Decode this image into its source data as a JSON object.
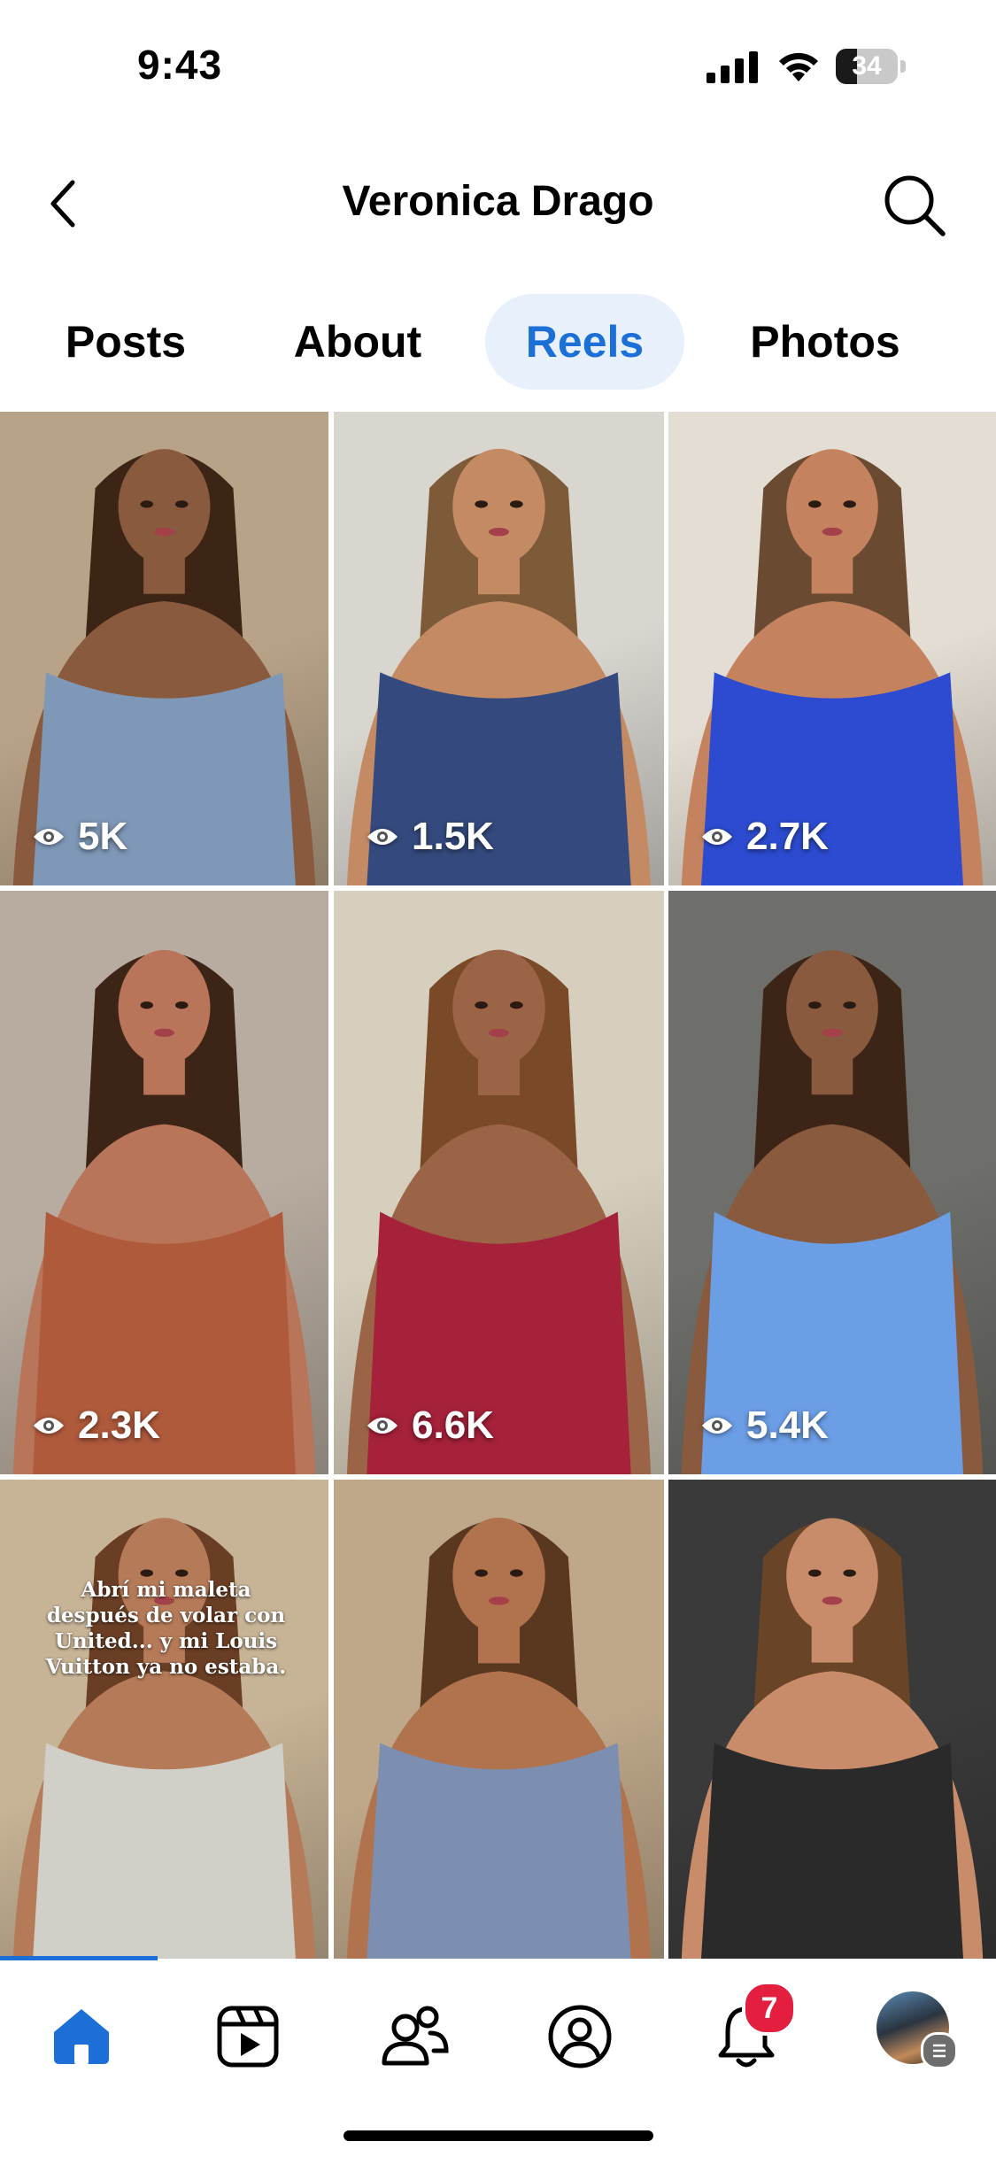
{
  "status_bar": {
    "time": "9:43",
    "battery_level": "34",
    "battery_fraction": 0.34
  },
  "header": {
    "title": "Veronica Drago",
    "back_icon": "chevron-left-icon",
    "search_icon": "search-icon"
  },
  "tabs": [
    {
      "label": "Posts",
      "active": false
    },
    {
      "label": "About",
      "active": false
    },
    {
      "label": "Reels",
      "active": true
    },
    {
      "label": "Photos",
      "active": false
    }
  ],
  "reels": [
    {
      "views": "5K",
      "bg": "#b9a388",
      "outfit": "#7f98b8",
      "skin": "#8a5a3e",
      "hair": "#3d2516"
    },
    {
      "views": "1.5K",
      "bg": "#d9d6d0",
      "outfit": "#344a7e",
      "skin": "#c48a64",
      "hair": "#7d5a38"
    },
    {
      "views": "2.7K",
      "bg": "#e4ddd3",
      "outfit": "#2c4bd0",
      "skin": "#c5825e",
      "hair": "#6a4a30"
    },
    {
      "views": "2.3K",
      "bg": "#b8aca0",
      "outfit": "#b05a3c",
      "skin": "#b8755a",
      "hair": "#3c2416"
    },
    {
      "views": "6.6K",
      "bg": "#d7cfbd",
      "outfit": "#a6213a",
      "skin": "#9c6446",
      "hair": "#7a4a28"
    },
    {
      "views": "5.4K",
      "bg": "#6e6e6a",
      "outfit": "#6c9ee6",
      "skin": "#8a5a3e",
      "hair": "#3c2416"
    },
    {
      "views": "",
      "bg": "#c7b395",
      "outfit": "#d0d0c8",
      "skin": "#b57a58",
      "hair": "#6a3e24",
      "caption": "Abrí mi maleta después de volar con United... y mi Louis Vuitton ya no estaba."
    },
    {
      "views": "",
      "bg": "#bfa88a",
      "outfit": "#7d8fb0",
      "skin": "#b0734e",
      "hair": "#5a3820"
    },
    {
      "views": "",
      "bg": "#3a3a3a",
      "outfit": "#2a2a2a",
      "skin": "#c98c6a",
      "hair": "#6a4426"
    }
  ],
  "bottom_nav": {
    "items": [
      "home-icon",
      "video-icon",
      "friends-icon",
      "profile-icon",
      "notifications-icon",
      "menu-avatar"
    ],
    "notifications_badge": "7",
    "active": "home-icon",
    "accent": "#1b6fd6"
  }
}
